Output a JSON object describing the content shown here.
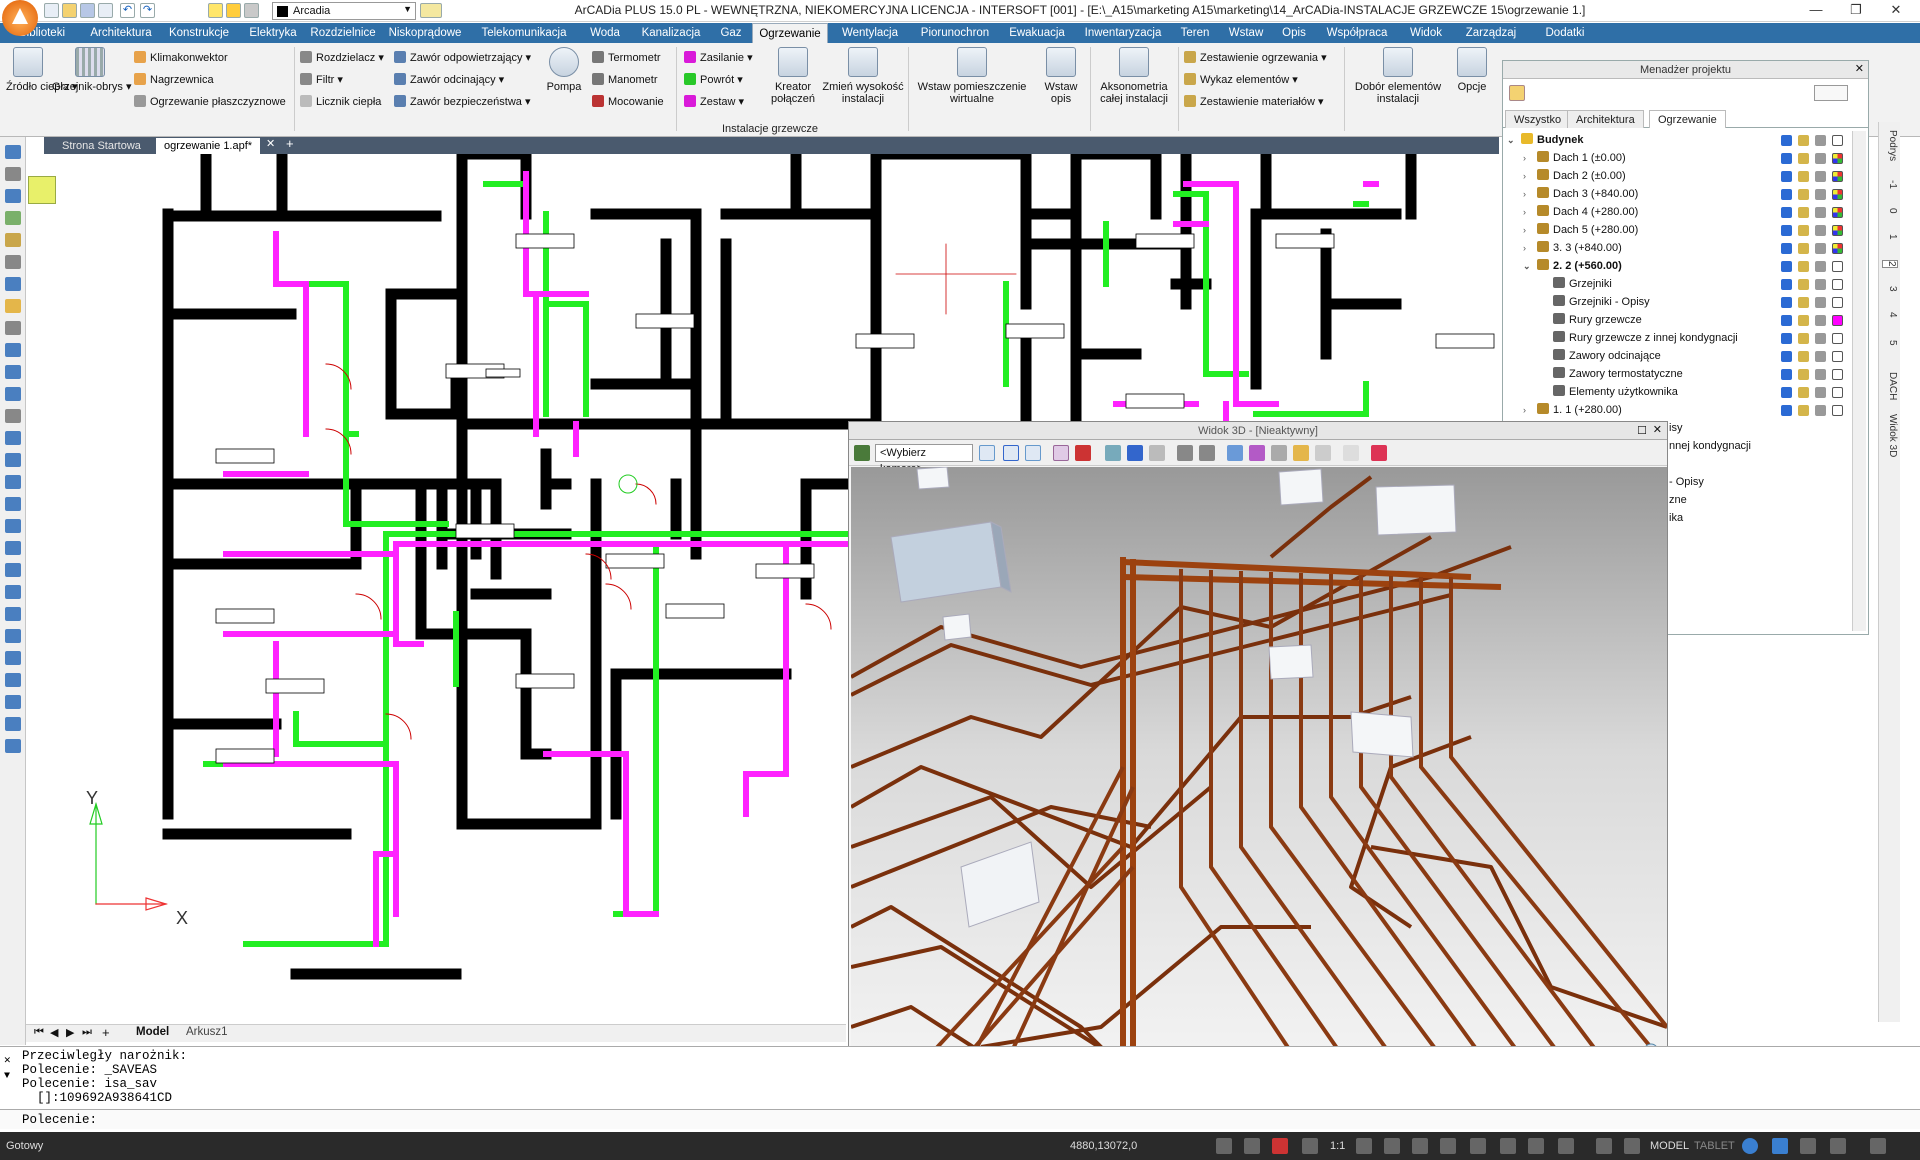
{
  "window": {
    "title": "ArCADia PLUS 15.0 PL - WEWNĘTRZNA, NIEKOMERCYJNA LICENCJA - INTERSOFT [001] - [E:\\_A15\\marketing A15\\marketing\\14_ArCADia-INSTALACJE GRZEWCZE 15\\ogrzewanie 1.]",
    "layer_combo": "Arcadia",
    "controls": {
      "minimize": "—",
      "restore": "❐",
      "close": "✕"
    }
  },
  "ribbon_tabs": [
    "Biblioteki",
    "Architektura",
    "Konstrukcje",
    "Elektryka",
    "Rozdzielnice",
    "Niskoprądowe",
    "Telekomunikacja",
    "Woda",
    "Kanalizacja",
    "Gaz",
    "Ogrzewanie",
    "Wentylacja",
    "Piorunochron",
    "Ewakuacja",
    "Inwentaryzacja",
    "Teren",
    "Wstaw",
    "Opis",
    "Współpraca",
    "Widok",
    "Zarządzaj",
    "Dodatki"
  ],
  "active_tab": "Ogrzewanie",
  "ribbon": {
    "zrodlo": "Źródło ciepła",
    "grzejnik": "Grzejnik-obrys",
    "klimakonwektor": "Klimakonwektor",
    "nagrzewnica": "Nagrzewnica",
    "ogrz_plaszcz": "Ogrzewanie płaszczyznowe",
    "rozdzielacz": "Rozdzielacz",
    "filtr": "Filtr",
    "licznik": "Licznik ciepła",
    "zawor_odp": "Zawór odpowietrzający",
    "zawor_odc": "Zawór odcinający",
    "zawor_bezp": "Zawór bezpieczeństwa",
    "pompa": "Pompa",
    "termometr": "Termometr",
    "manometr": "Manometr",
    "mocowanie": "Mocowanie",
    "zasilanie": "Zasilanie",
    "powrot": "Powrót",
    "zestaw": "Zestaw",
    "kreator": "Kreator połączeń",
    "zmien": "Zmień wysokość instalacji",
    "wstaw_pom": "Wstaw pomieszczenie wirtualne",
    "wstaw_opis": "Wstaw opis",
    "aksonometria": "Aksonometria całej instalacji",
    "zest_ogrz": "Zestawienie ogrzewania",
    "wykaz": "Wykaz elementów",
    "zest_mat": "Zestawienie materiałów",
    "dobor": "Dobór elementów instalacji",
    "opcje": "Opcje",
    "group_label": "Instalacje grzewcze"
  },
  "doc_tabs": [
    "Strona Startowa",
    "ogrzewanie 1.apf*"
  ],
  "model_tabs": [
    "Model",
    "Arkusz1"
  ],
  "project_manager": {
    "title": "Menadżer projektu",
    "tabs": [
      "Wszystko",
      "Architektura",
      "Ogrzewanie"
    ],
    "active_tab": "Ogrzewanie",
    "tree": [
      {
        "label": "Budynek",
        "level": 0,
        "bold": true,
        "pink": false
      },
      {
        "label": "Dach 1 (±0.00)",
        "level": 1,
        "bold": false,
        "pink": false
      },
      {
        "label": "Dach 2 (±0.00)",
        "level": 1,
        "bold": false,
        "pink": false
      },
      {
        "label": "Dach 3 (+840.00)",
        "level": 1,
        "bold": false,
        "pink": false
      },
      {
        "label": "Dach 4 (+280.00)",
        "level": 1,
        "bold": false,
        "pink": false
      },
      {
        "label": "Dach 5 (+280.00)",
        "level": 1,
        "bold": false,
        "pink": false
      },
      {
        "label": "3. 3 (+840.00)",
        "level": 1,
        "bold": false,
        "pink": false
      },
      {
        "label": "2. 2 (+560.00)",
        "level": 1,
        "bold": true,
        "pink": false
      },
      {
        "label": "Grzejniki",
        "level": 2,
        "bold": false,
        "pink": false
      },
      {
        "label": "Grzejniki - Opisy",
        "level": 2,
        "bold": false,
        "pink": false
      },
      {
        "label": "Rury grzewcze",
        "level": 2,
        "bold": false,
        "pink": true
      },
      {
        "label": "Rury grzewcze z innej kondygnacji",
        "level": 2,
        "bold": false,
        "pink": false
      },
      {
        "label": "Zawory odcinające",
        "level": 2,
        "bold": false,
        "pink": false
      },
      {
        "label": "Zawory termostatyczne",
        "level": 2,
        "bold": false,
        "pink": false
      },
      {
        "label": "Elementy użytkownika",
        "level": 2,
        "bold": false,
        "pink": false
      },
      {
        "label": "1. 1 (+280.00)",
        "level": 1,
        "bold": false,
        "pink": false
      }
    ],
    "obscured_fragments": [
      "isy",
      "nnej kondygnacji",
      "- Opisy",
      "zne",
      "ika"
    ]
  },
  "right_bar_labels": [
    "Podrys",
    "-1",
    "0",
    "1",
    "2",
    "3",
    "4",
    "5",
    "DACH",
    "Widok 3D"
  ],
  "view3d": {
    "title": "Widok 3D - [Nieaktywny]",
    "camera_select": "<Wybierz kamerę>"
  },
  "command_lines": [
    "Przeciwległy narożnik:",
    "Polecenie: _SAVEAS",
    "Polecenie: isa_sav",
    "  []:109692A938641CD"
  ],
  "command_prompt": "Polecenie:",
  "status": {
    "ready": "Gotowy",
    "coords": "4880,13072,0",
    "scale": "1:1",
    "model": "MODEL",
    "tablet": "TABLET"
  },
  "axes": {
    "y": "Y",
    "x": "X"
  },
  "colors": {
    "ribbon_blue": "#2f6fa7",
    "supply": "#ff22ff",
    "return": "#22ee22",
    "wall": "#000000",
    "pipe3d": "#8a3a12"
  }
}
